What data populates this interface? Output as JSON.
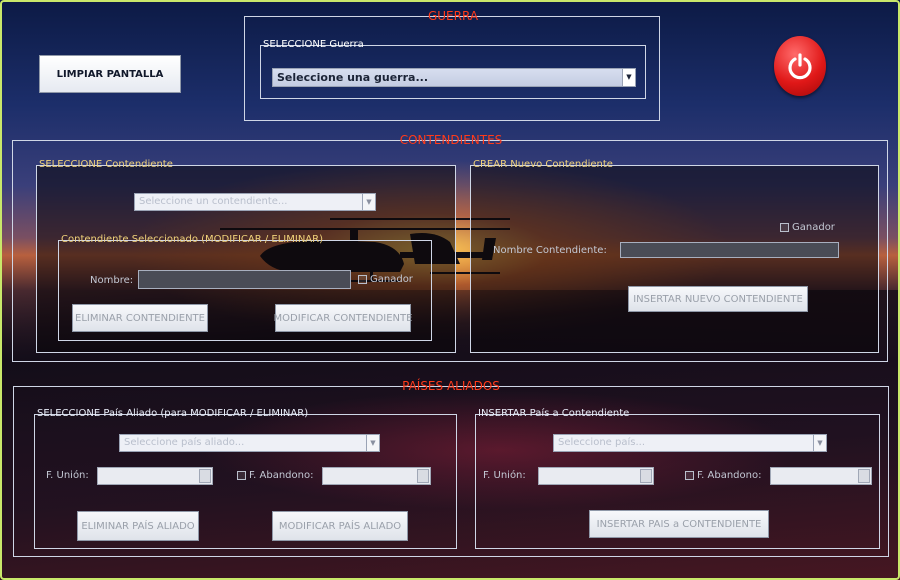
{
  "toolbar": {
    "clear_label": "LIMPIAR PANTALLA"
  },
  "guerra": {
    "title": "GUERRA",
    "select_title": "SELECCIONE Guerra",
    "select_value": "Seleccione una guerra..."
  },
  "contendientes": {
    "title": "CONTENDIENTES",
    "select_panel": {
      "title": "SELECCIONE Contendiente",
      "combo_value": "Seleccione un contendiente...",
      "selected": {
        "title": "Contendiente Seleccionado (MODIFICAR / ELIMINAR)",
        "name_label": "Nombre:",
        "winner_label": "Ganador",
        "delete_label": "ELIMINAR CONTENDIENTE",
        "modify_label": "MODIFICAR CONTENDIENTE"
      }
    },
    "create_panel": {
      "title": "CREAR Nuevo Contendiente",
      "winner_label": "Ganador",
      "name_label": "Nombre Contendiente:",
      "insert_label": "INSERTAR NUEVO CONTENDIENTE"
    }
  },
  "aliados": {
    "title": "PAÍSES ALIADOS",
    "select_panel": {
      "title": "SELECCIONE País Aliado (para MODIFICAR / ELIMINAR)",
      "combo_value": "Seleccione país aliado...",
      "union_label": "F. Unión:",
      "abandono_label": "F. Abandono:",
      "delete_label": "ELIMINAR PAÍS ALIADO",
      "modify_label": "MODIFICAR PAÍS ALIADO"
    },
    "insert_panel": {
      "title": "INSERTAR País a Contendiente",
      "combo_value": "Seleccione país...",
      "union_label": "F. Unión:",
      "abandono_label": "F. Abandono:",
      "insert_label": "INSERTAR PAIS a CONTENDIENTE"
    }
  },
  "icons": {
    "power": "power-icon"
  },
  "colors": {
    "section_title": "#ff3a1a",
    "frame": "#c9e86a",
    "power_button": "#e01818"
  }
}
